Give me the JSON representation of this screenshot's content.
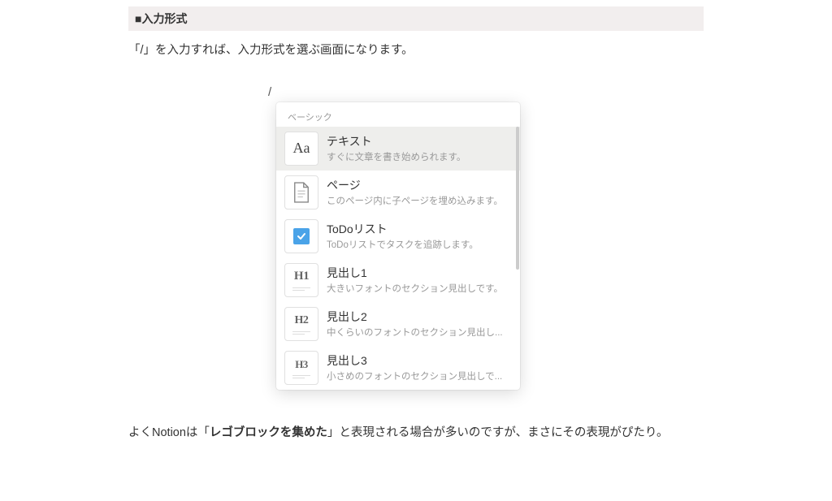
{
  "header": {
    "title": "■入力形式"
  },
  "description": "「/」を入力すれば、入力形式を選ぶ画面になります。",
  "slash": "/",
  "popup": {
    "section_label": "ベーシック",
    "items": [
      {
        "title": "テキスト",
        "desc": "すぐに文章を書き始められます。",
        "icon": "Aa"
      },
      {
        "title": "ページ",
        "desc": "このページ内に子ページを埋め込みます。",
        "icon": "page"
      },
      {
        "title": "ToDoリスト",
        "desc": "ToDoリストでタスクを追跡します。",
        "icon": "check"
      },
      {
        "title": "見出し1",
        "desc": "大きいフォントのセクション見出しです。",
        "icon": "H1"
      },
      {
        "title": "見出し2",
        "desc": "中くらいのフォントのセクション見出し...",
        "icon": "H2"
      },
      {
        "title": "見出し3",
        "desc": "小さめのフォントのセクション見出しで...",
        "icon": "H3"
      }
    ]
  },
  "footer": {
    "pre": "よくNotionは「",
    "bold": "レゴブロックを集めた",
    "post": "」と表現される場合が多いのですが、まさにその表現がぴたり。"
  }
}
